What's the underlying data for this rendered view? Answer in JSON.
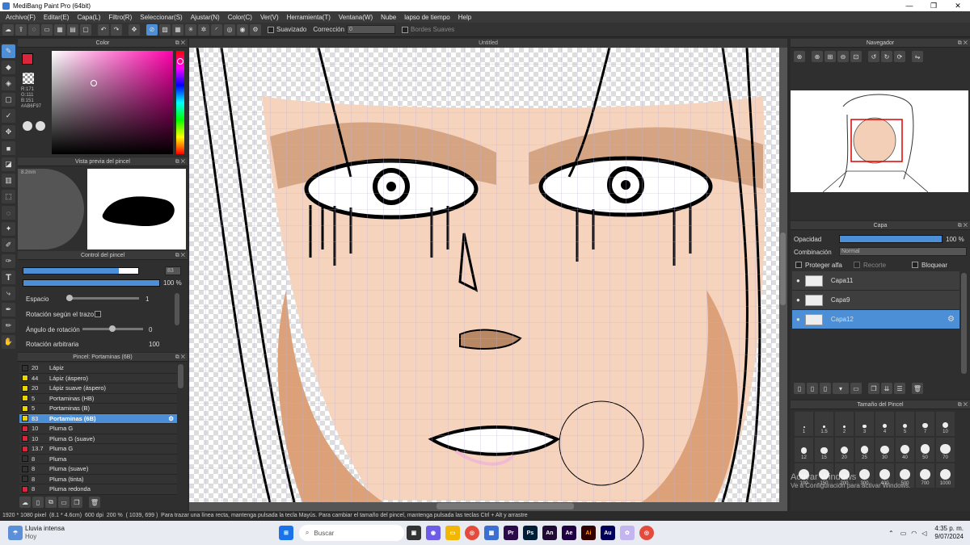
{
  "window": {
    "title": "MediBang Paint Pro (64bit)"
  },
  "menu": [
    "Archivo(F)",
    "Editar(E)",
    "Capa(L)",
    "Filtro(R)",
    "Seleccionar(S)",
    "Ajustar(N)",
    "Color(C)",
    "Ver(V)",
    "Herramienta(T)",
    "Ventana(W)",
    "Nube",
    "lapso de tiempo",
    "Help"
  ],
  "toolbar": {
    "smoothing_label": "Suavizado",
    "correction_label": "Corrección",
    "correction_value": "0",
    "soft_edges_label": "Bordes Suaves"
  },
  "color_panel": {
    "title": "Color",
    "r": "R:171",
    "g": "G:111",
    "b": "B:151",
    "hex": "#AB6F97",
    "primary": "#d9263b",
    "accent": "#4d8fd6"
  },
  "brush_preview": {
    "title": "Vista previa del pincel",
    "size_label": "8.2mm"
  },
  "brush_control": {
    "title": "Control del pincel",
    "size_value": "83",
    "opacity_value": "100 %",
    "spacing_label": "Espacio",
    "spacing_value": "1",
    "rotation_stroke_label": "Rotación según el trazo",
    "rotation_angle_label": "Ángulo de rotación",
    "rotation_angle_value": "0",
    "arbitrary_rotation_label": "Rotación arbitraria",
    "arbitrary_rotation_value": "100"
  },
  "brush_list": {
    "title": "Pincel: Portaminas (6B)",
    "items": [
      {
        "size": "20",
        "name": "Lápiz",
        "color": "#333333"
      },
      {
        "size": "44",
        "name": "Lápiz (áspero)",
        "color": "#e8d400"
      },
      {
        "size": "20",
        "name": "Lápiz suave (áspero)",
        "color": "#e8d400"
      },
      {
        "size": "5",
        "name": "Portaminas (HB)",
        "color": "#e8d400"
      },
      {
        "size": "5",
        "name": "Portaminas (B)",
        "color": "#e8d400"
      },
      {
        "size": "83",
        "name": "Portaminas (6B)",
        "color": "#e8d400",
        "selected": true
      },
      {
        "size": "10",
        "name": "Pluma G",
        "color": "#d9263b"
      },
      {
        "size": "10",
        "name": "Pluma G (suave)",
        "color": "#d9263b"
      },
      {
        "size": "13.7",
        "name": "Pluma G",
        "color": "#d9263b"
      },
      {
        "size": "8",
        "name": "Pluma",
        "color": "#333333"
      },
      {
        "size": "8",
        "name": "Pluma (suave)",
        "color": "#333333"
      },
      {
        "size": "8",
        "name": "Pluma (tinta)",
        "color": "#333333"
      },
      {
        "size": "8",
        "name": "Pluma redonda",
        "color": "#d9263b"
      }
    ]
  },
  "canvas": {
    "tab_title": "Untitled"
  },
  "navigator": {
    "title": "Navegador"
  },
  "layers": {
    "title": "Capa",
    "opacity_label": "Opacidad",
    "opacity_value": "100 %",
    "blend_label": "Combinación",
    "blend_value": "Normal",
    "protect_alpha": "Proteger alfa",
    "clip": "Recorte",
    "lock": "Bloquear",
    "items": [
      {
        "name": "Capa11"
      },
      {
        "name": "Capa9"
      },
      {
        "name": "Capa12",
        "selected": true
      }
    ]
  },
  "brush_size": {
    "title": "Tamaño del Pincel",
    "sizes": [
      "1",
      "1.5",
      "2",
      "3",
      "4",
      "5",
      "7",
      "10",
      "12",
      "15",
      "20",
      "25",
      "30",
      "40",
      "50",
      "70",
      "100",
      "150",
      "200",
      "300",
      "400",
      "500",
      "700",
      "1000"
    ]
  },
  "watermark": {
    "line1": "Activar Windows",
    "line2": "Ve a Configuración para activar Windows."
  },
  "status": {
    "dims": "1920 * 1080 pixel",
    "cm": "(8.1 * 4.6cm)",
    "dpi": "600 dpi",
    "zoom": "200 %",
    "coords": "( 1039, 699 )",
    "hint": "Para trazar una línea recta, mantenga pulsada la tecla Mayús. Para cambiar el tamaño del pincel, mantenga pulsada las teclas Ctrl + Alt y arrastre"
  },
  "taskbar": {
    "weather_title": "Lluvia intensa",
    "weather_sub": "Hoy",
    "search_placeholder": "Buscar",
    "time": "4:35 p. m.",
    "date": "9/07/2024"
  }
}
